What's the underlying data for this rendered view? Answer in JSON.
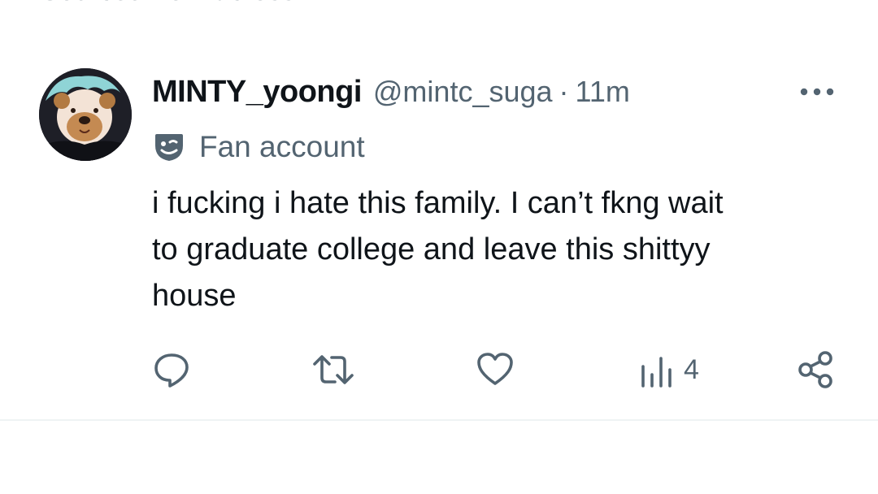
{
  "top_clipped_text": "Sourced from across X",
  "tweet": {
    "display_name": "MINTY_yoongi",
    "handle": "@mintc_suga",
    "separator": "·",
    "time": "11m",
    "label": "Fan account",
    "text": "i fucking i hate this family. I can’t fkng wait\nto graduate college and leave this shittyy\nhouse",
    "actions": {
      "views_count": "4"
    }
  },
  "icons": {
    "more": "more-horizontal-icon",
    "label": "theater-mask-icon",
    "reply": "reply-icon",
    "retweet": "retweet-icon",
    "like": "heart-icon",
    "views": "views-bar-chart-icon",
    "share": "share-icon"
  },
  "colors": {
    "text_primary": "#0f1419",
    "text_secondary": "#536471",
    "divider": "#eff3f4"
  }
}
